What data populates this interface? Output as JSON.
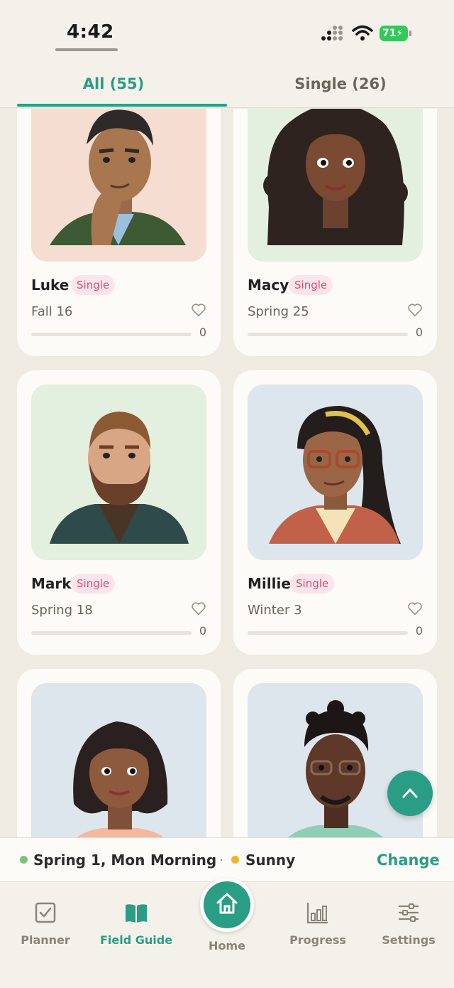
{
  "status_bar": {
    "time": "4:42",
    "battery": "71"
  },
  "tabs": [
    {
      "label": "All (55)",
      "active": true
    },
    {
      "label": "Single (26)",
      "active": false
    }
  ],
  "cards": [
    {
      "name": "Luke",
      "badge": "Single",
      "date": "Fall 16",
      "count": "0",
      "bg": "#f5ddd1",
      "progress": 0
    },
    {
      "name": "Macy",
      "badge": "Single",
      "date": "Spring 25",
      "count": "0",
      "bg": "#e3efdf",
      "progress": 0
    },
    {
      "name": "Mark",
      "badge": "Single",
      "date": "Spring 18",
      "count": "0",
      "bg": "#e3efdf",
      "progress": 0
    },
    {
      "name": "Millie",
      "badge": "Single",
      "date": "Winter 3",
      "count": "0",
      "bg": "#dde6ec",
      "progress": 0
    },
    {
      "name": "",
      "badge": "",
      "date": "",
      "count": "",
      "bg": "#dde6ec",
      "progress": 0
    },
    {
      "name": "",
      "badge": "",
      "date": "",
      "count": "",
      "bg": "#dde6ec",
      "progress": 0
    }
  ],
  "info_bar": {
    "date": "Spring 1, Mon",
    "time_of_day": "Morning",
    "weather": "Sunny",
    "change_label": "Change",
    "date_dot_color": "#7cc27a",
    "weather_dot_color": "#f0b429"
  },
  "nav": {
    "planner": "Planner",
    "field_guide": "Field Guide",
    "home": "Home",
    "progress": "Progress",
    "settings": "Settings"
  },
  "colors": {
    "accent": "#2a9d85",
    "badge_text": "#d0527a",
    "badge_bg": "#fbe4ea"
  },
  "icons": [
    "signal-icon",
    "wifi-icon",
    "battery-icon",
    "heart-icon",
    "chevron-up-icon",
    "checkbox-icon",
    "book-icon",
    "home-icon",
    "bar-chart-icon",
    "sliders-icon"
  ]
}
